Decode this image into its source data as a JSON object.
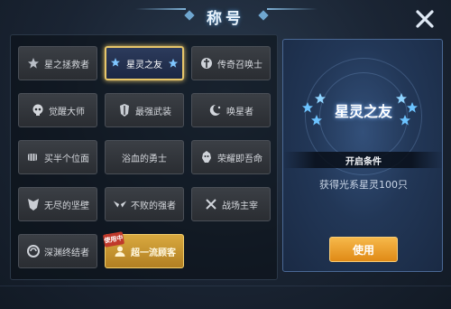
{
  "header": {
    "title": "称号",
    "close_icon": "close-icon"
  },
  "titles": [
    {
      "label": "星之拯救者",
      "icon": "star-emblem-icon",
      "state": "normal"
    },
    {
      "label": "星灵之友",
      "icon": "stars-icon",
      "state": "selected"
    },
    {
      "label": "传奇召唤士",
      "icon": "sword-emblem-icon",
      "state": "normal"
    },
    {
      "label": "觉醒大师",
      "icon": "skull-icon",
      "state": "normal"
    },
    {
      "label": "最强武装",
      "icon": "armor-icon",
      "state": "normal"
    },
    {
      "label": "唤星者",
      "icon": "moon-star-icon",
      "state": "normal"
    },
    {
      "label": "买半个位面",
      "icon": "fist-icon",
      "state": "normal"
    },
    {
      "label": "浴血的勇士",
      "icon": "blood-icon",
      "state": "normal"
    },
    {
      "label": "荣耀即吾命",
      "icon": "lion-icon",
      "state": "normal"
    },
    {
      "label": "无尽的坚壁",
      "icon": "shield-icon",
      "state": "normal"
    },
    {
      "label": "不败的强者",
      "icon": "wings-icon",
      "state": "normal"
    },
    {
      "label": "战场主宰",
      "icon": "crossed-swords-icon",
      "state": "normal"
    },
    {
      "label": "深渊终结者",
      "icon": "vortex-icon",
      "state": "normal"
    },
    {
      "label": "超一流顾客",
      "icon": "user-icon",
      "state": "active",
      "badge": "使用中"
    }
  ],
  "detail": {
    "title": "星灵之友",
    "condition_header": "开启条件",
    "condition_text": "获得光系星灵100只",
    "use_button": "使用"
  },
  "colors": {
    "accent_gold": "#e7c66a",
    "use_button": "#f0a030",
    "panel_blue": "#223757"
  }
}
